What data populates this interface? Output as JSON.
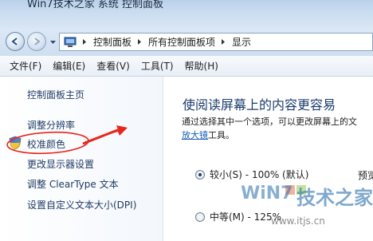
{
  "window": {
    "title_partial": "Win7技术之家 系统 控制面板"
  },
  "nav": {
    "breadcrumbs": [
      "控制面板",
      "所有控制面板项",
      "显示"
    ]
  },
  "menu": [
    "文件(F)",
    "编辑(E)",
    "查看(V)",
    "工具(T)",
    "帮助(H)"
  ],
  "sidebar": {
    "home": "控制面板主页",
    "items": [
      "调整分辨率",
      "校准颜色",
      "更改显示器设置",
      "调整 ClearType 文本",
      "设置自定义文本大小(DPI)"
    ]
  },
  "main": {
    "heading": "使阅读屏幕上的内容更容易",
    "description_line1": "通过选择其中一个选项，可以更改屏幕上的文",
    "magnifier_link": "放大镜",
    "description_line2_suffix": "工具。",
    "options": [
      {
        "label": "较小(S) - 100% (默认)",
        "checked": true
      },
      {
        "label": "中等(M) - 125%",
        "checked": false
      }
    ],
    "preview_label": "预览"
  },
  "watermark": {
    "brand_en": "WiN7",
    "brand_cn": "技术之家",
    "url": "www.itjs.cn"
  },
  "colors": {
    "annotation": "#e8261c",
    "link": "#1f3b63",
    "heading": "#1b3d6d"
  }
}
